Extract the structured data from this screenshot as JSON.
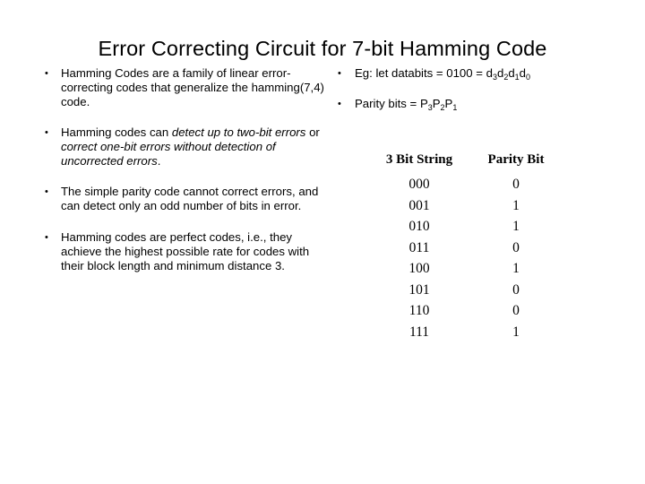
{
  "slide": {
    "title": "Error Correcting Circuit for 7-bit Hamming Code",
    "background_color": "#ffffff",
    "text_color": "#000000"
  },
  "left_column": {
    "bullets": [
      {
        "id": "hamming-codes-family",
        "parts": [
          {
            "text": "Hamming Codes are a family of linear error-correcting codes that generalize the hamming(7,4) code.",
            "style": "normal"
          }
        ]
      },
      {
        "id": "detect-correct",
        "parts": [
          {
            "text": "Hamming codes can ",
            "style": "normal"
          },
          {
            "text": "detect up to two-bit errors",
            "style": "italic"
          },
          {
            "text": " or ",
            "style": "normal"
          },
          {
            "text": "correct one-bit errors without detection of uncorrected errors",
            "style": "italic"
          },
          {
            "text": ".",
            "style": "normal"
          }
        ]
      },
      {
        "id": "simple-parity-code",
        "parts": [
          {
            "text": "The simple parity code cannot correct errors, and can detect only an odd number of bits in error.",
            "style": "normal"
          }
        ]
      },
      {
        "id": "perfect-codes",
        "parts": [
          {
            "text": "Hamming codes are perfect codes, i.e., they achieve the highest possible rate for codes with their block length and minimum distance 3.",
            "style": "normal"
          }
        ]
      }
    ]
  },
  "right_column": {
    "bullets": [
      {
        "id": "example-databits",
        "prefix": "Eg: let databits = 0100 = ",
        "symbols": [
          {
            "base": "d",
            "sub": "3"
          },
          {
            "base": "d",
            "sub": "2"
          },
          {
            "base": "d",
            "sub": "1"
          },
          {
            "base": "d",
            "sub": "0"
          }
        ]
      },
      {
        "id": "parity-bits",
        "prefix": "Parity bits = ",
        "symbols": [
          {
            "base": "P",
            "sub": "3"
          },
          {
            "base": "P",
            "sub": "2"
          },
          {
            "base": "P",
            "sub": "1"
          }
        ]
      }
    ]
  },
  "parity_table": {
    "headers": [
      "3 Bit String",
      "Parity Bit"
    ],
    "rows": [
      [
        "000",
        "0"
      ],
      [
        "001",
        "1"
      ],
      [
        "010",
        "1"
      ],
      [
        "011",
        "0"
      ],
      [
        "100",
        "1"
      ],
      [
        "101",
        "0"
      ],
      [
        "110",
        "0"
      ],
      [
        "111",
        "1"
      ]
    ]
  }
}
